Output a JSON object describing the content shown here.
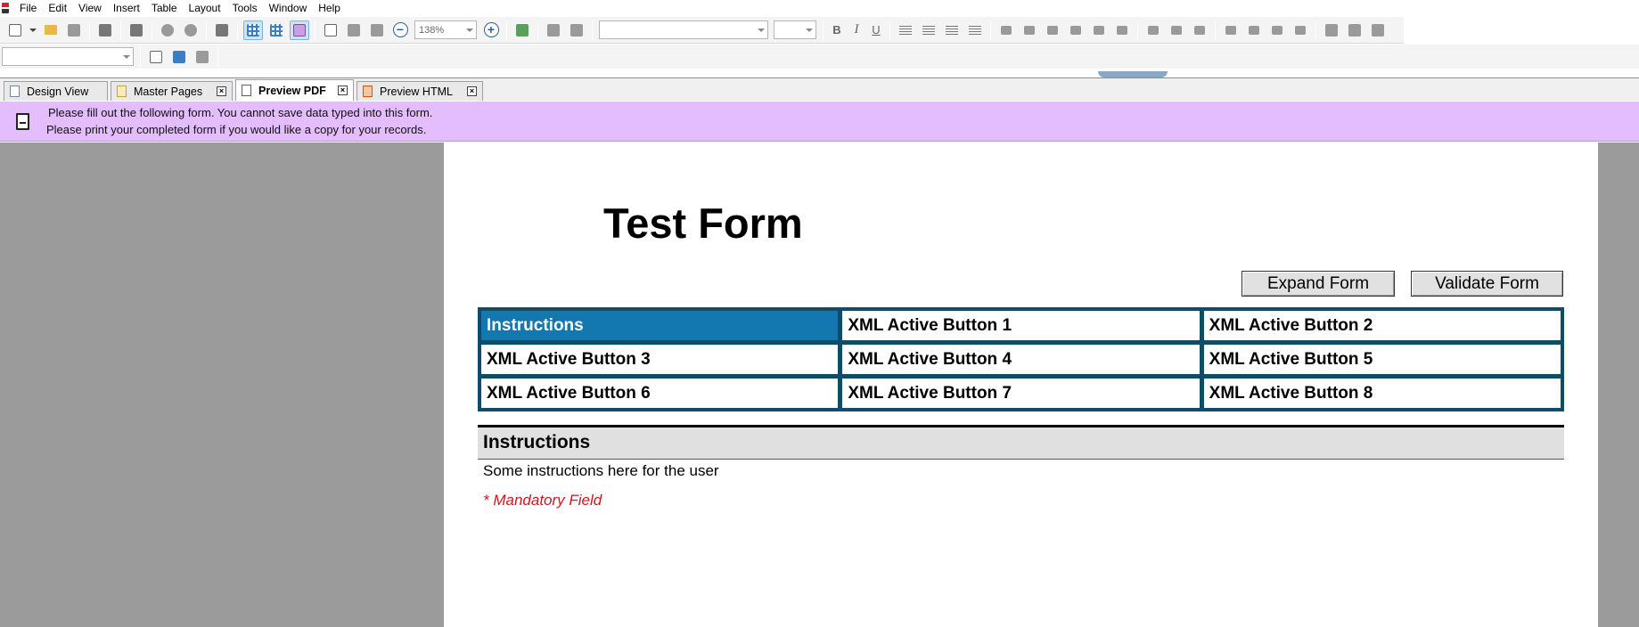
{
  "menu": [
    "File",
    "Edit",
    "View",
    "Insert",
    "Table",
    "Layout",
    "Tools",
    "Window",
    "Help"
  ],
  "toolbar": {
    "zoom": "138%",
    "font_name": "",
    "font_size": "",
    "bold": "B",
    "italic": "I",
    "underline": "U"
  },
  "tabs": [
    {
      "label": "Design View",
      "active": false,
      "closable": false
    },
    {
      "label": "Master Pages",
      "active": false,
      "closable": true
    },
    {
      "label": "Preview PDF",
      "active": true,
      "closable": true
    },
    {
      "label": "Preview HTML",
      "active": false,
      "closable": true
    }
  ],
  "notice": {
    "line1": "Please fill out the following form. You cannot save data typed into this form.",
    "line2": "Please print your completed form if you would like a copy for your records."
  },
  "form": {
    "title": "Test Form",
    "expand_button": "Expand Form",
    "validate_button": "Validate Form",
    "nav_buttons": [
      "Instructions",
      "XML Active Button 1",
      "XML Active Button 2",
      "XML Active Button 3",
      "XML Active Button 4",
      "XML Active Button 5",
      "XML Active Button 6",
      "XML Active Button 7",
      "XML Active Button 8"
    ],
    "selected_nav": "Instructions",
    "section_title": "Instructions",
    "instructions_text": "Some instructions here for the user",
    "mandatory_note": "* Mandatory Field"
  },
  "colors": {
    "notice_bg": "#e3bdfd",
    "nav_border": "#0f4c6a",
    "nav_selected": "#1478b0",
    "mandatory": "#d0161d"
  }
}
